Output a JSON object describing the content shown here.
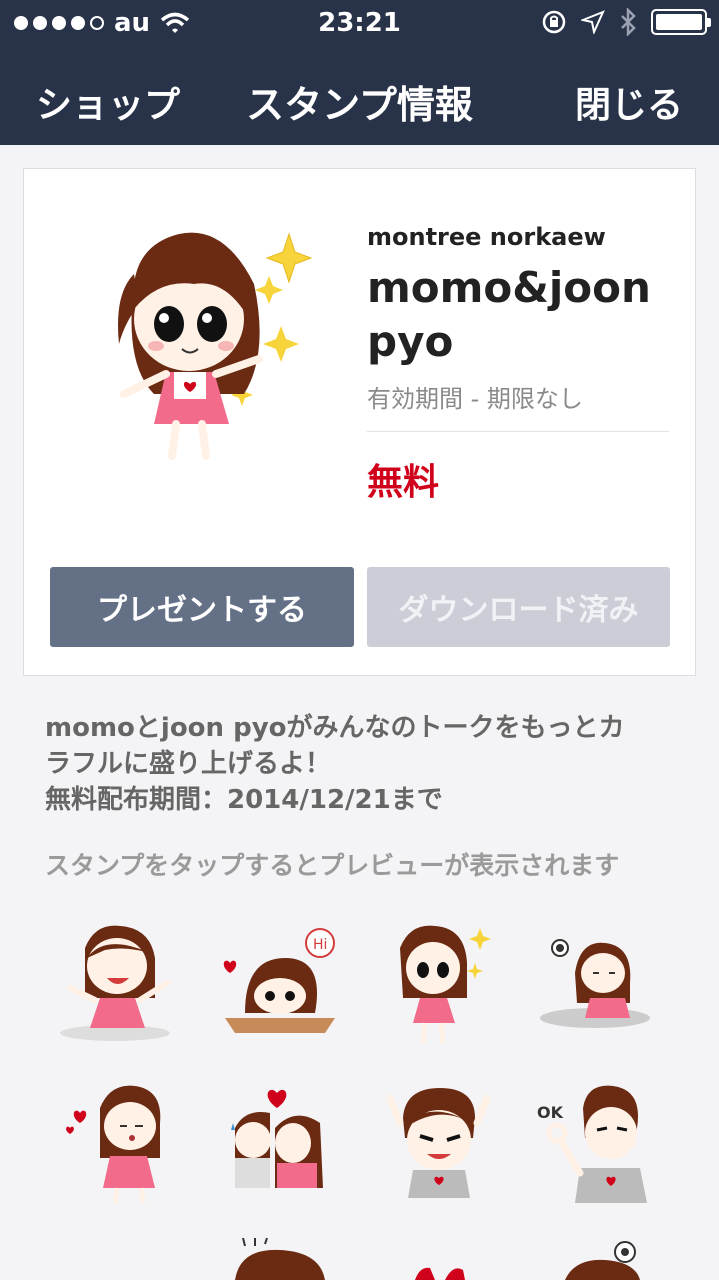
{
  "status": {
    "carrier": "au",
    "time": "23:21",
    "signal_icon": "signal-dots-icon",
    "wifi_icon": "wifi-icon",
    "lock_icon": "rotation-lock-icon",
    "location_icon": "location-arrow-icon",
    "bluetooth_icon": "bluetooth-icon",
    "battery_icon": "battery-icon"
  },
  "nav": {
    "shop": "ショップ",
    "title": "スタンプ情報",
    "close": "閉じる"
  },
  "product": {
    "author": "montree norkaew",
    "name": "momo&joon pyo",
    "validity": "有効期間 - 期限なし",
    "price": "無料",
    "gift_button": "プレゼントする",
    "download_button": "ダウンロード済み"
  },
  "description": {
    "line1": "momoとjoon pyoがみんなのトークをもっとカ",
    "line2": "ラフルに盛り上げるよ！",
    "line3": "無料配布期間：2014/12/21まで"
  },
  "preview_hint": "スタンプをタップするとプレビューが表示されます",
  "colors": {
    "header": "#283349",
    "price": "#d0021b",
    "gift_button": "#647085",
    "download_button": "#cbced6"
  }
}
